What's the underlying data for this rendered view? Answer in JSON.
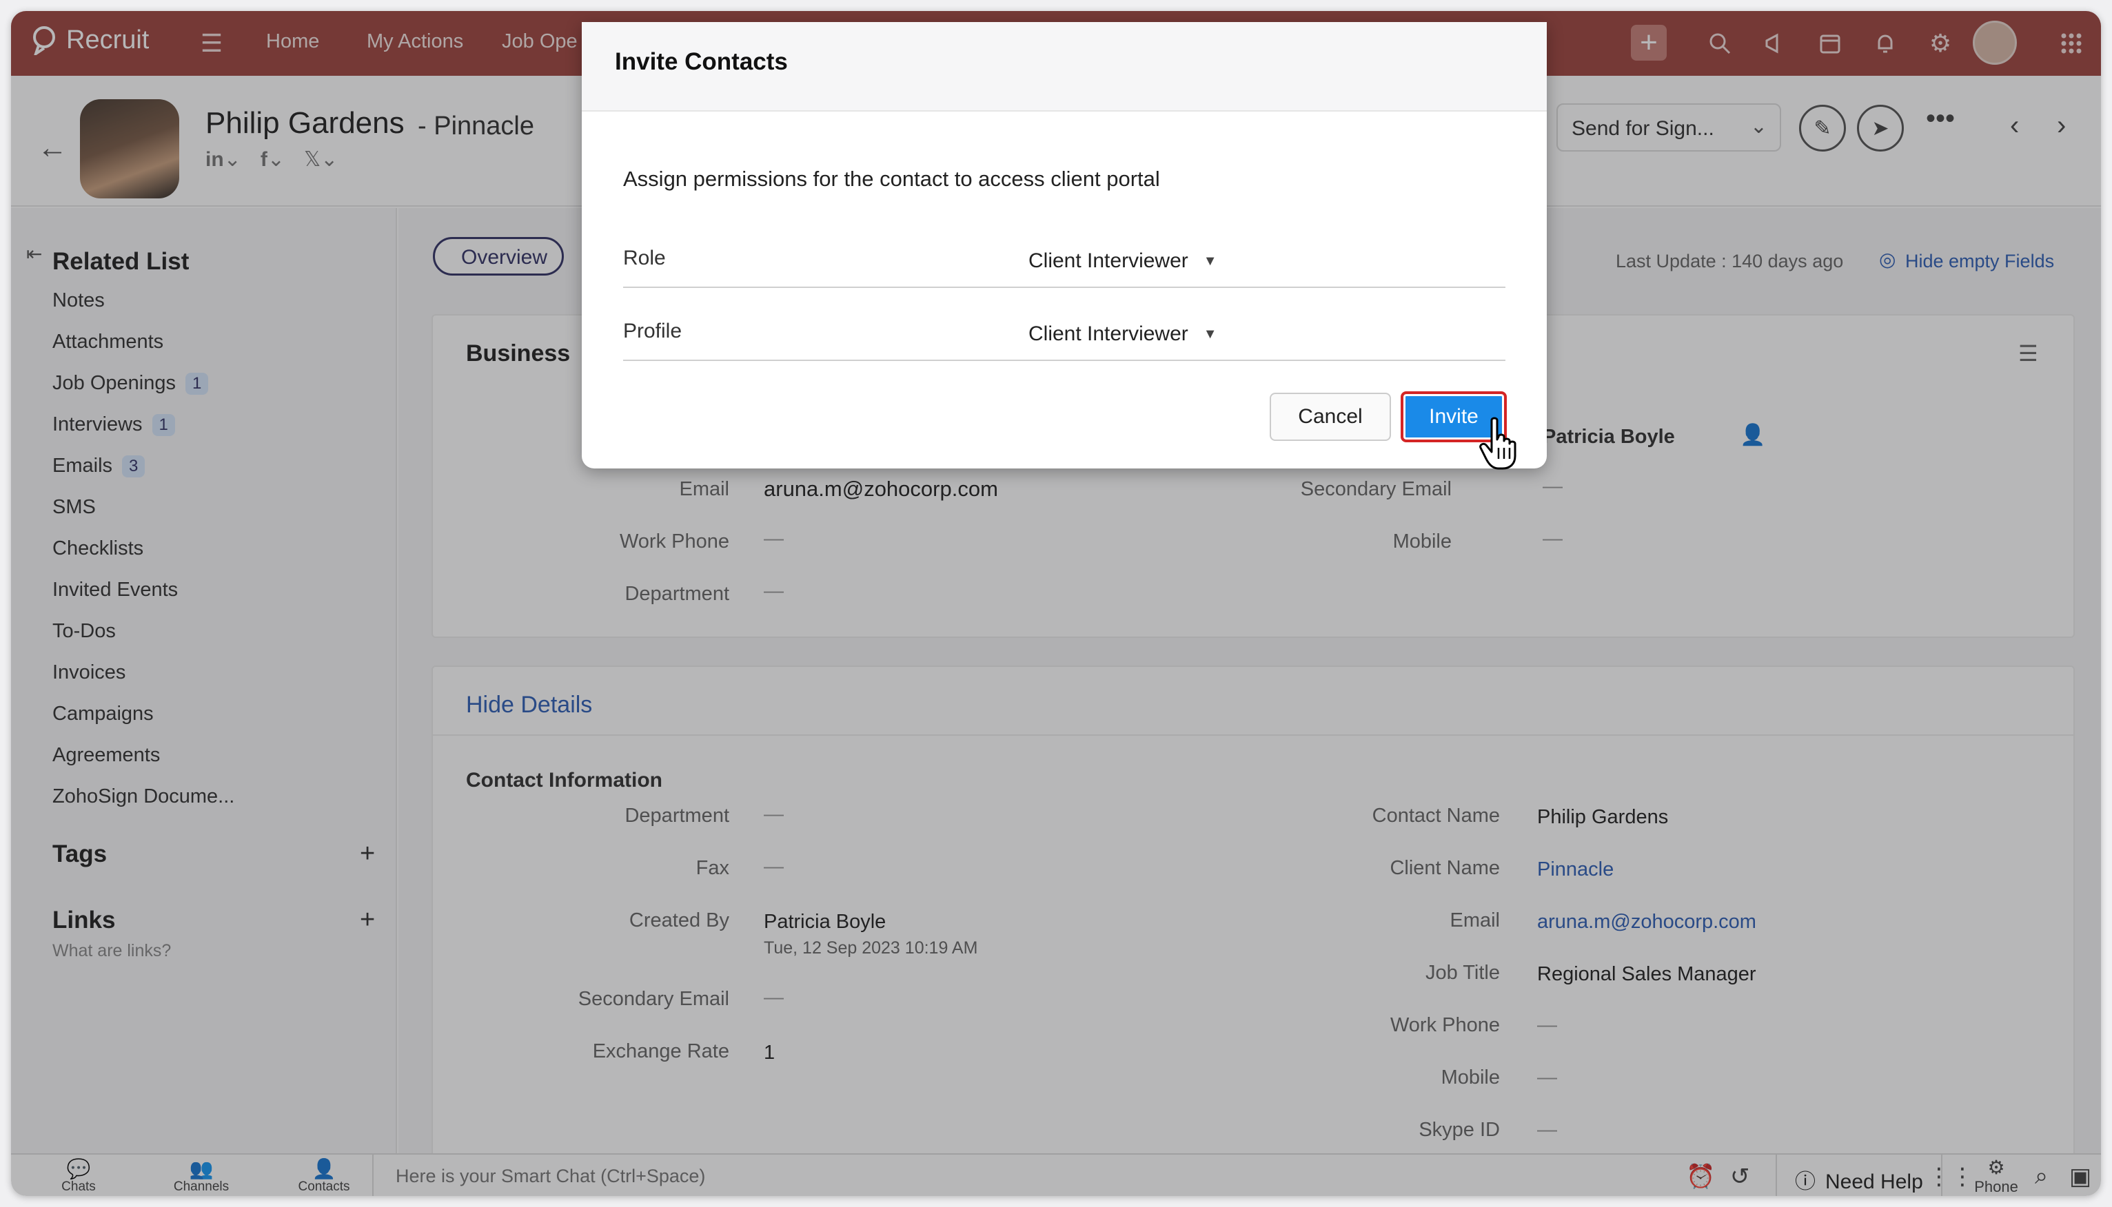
{
  "topbar": {
    "app_name": "Recruit",
    "nav": [
      "Home",
      "My Actions",
      "Job Ope"
    ]
  },
  "header": {
    "contact_name": "Philip Gardens",
    "client_name": "Pinnacle",
    "social": [
      "in",
      "f",
      "𝕏"
    ],
    "send_for_sign": "Send for Sign..."
  },
  "sidebar": {
    "related_title": "Related List",
    "items": [
      {
        "label": "Notes",
        "badge": ""
      },
      {
        "label": "Attachments",
        "badge": ""
      },
      {
        "label": "Job Openings",
        "badge": "1"
      },
      {
        "label": "Interviews",
        "badge": "1"
      },
      {
        "label": "Emails",
        "badge": "3"
      },
      {
        "label": "SMS",
        "badge": ""
      },
      {
        "label": "Checklists",
        "badge": ""
      },
      {
        "label": "Invited Events",
        "badge": ""
      },
      {
        "label": "To-Dos",
        "badge": ""
      },
      {
        "label": "Invoices",
        "badge": ""
      },
      {
        "label": "Campaigns",
        "badge": ""
      },
      {
        "label": "Agreements",
        "badge": ""
      },
      {
        "label": "ZohoSign Docume...",
        "badge": ""
      }
    ],
    "tags_title": "Tags",
    "links_title": "Links",
    "links_hint": "What are links?"
  },
  "main": {
    "tab_overview": "Overview",
    "last_update": "Last Update : 140 days ago",
    "hide_empty": "Hide empty Fields",
    "business_card": {
      "title": "Business",
      "owner_value": "Patricia Boyle",
      "email_label": "Email",
      "email_value": "aruna.m@zohocorp.com",
      "work_phone_label": "Work Phone",
      "department_label": "Department",
      "secondary_email_label": "Secondary Email",
      "mobile_label": "Mobile",
      "dash": "—"
    },
    "details_card": {
      "hide_details": "Hide Details",
      "section_title": "Contact Information",
      "left": [
        {
          "label": "Department",
          "value": "—"
        },
        {
          "label": "Fax",
          "value": "—"
        },
        {
          "label": "Created By",
          "value": "Patricia Boyle",
          "sub": "Tue, 12 Sep 2023 10:19 AM"
        },
        {
          "label": "Secondary Email",
          "value": "—"
        },
        {
          "label": "Exchange Rate",
          "value": "1"
        }
      ],
      "right": [
        {
          "label": "Contact Name",
          "value": "Philip Gardens"
        },
        {
          "label": "Client Name",
          "value": "Pinnacle"
        },
        {
          "label": "Email",
          "value": "aruna.m@zohocorp.com"
        },
        {
          "label": "Job Title",
          "value": "Regional Sales Manager"
        },
        {
          "label": "Work Phone",
          "value": "—"
        },
        {
          "label": "Mobile",
          "value": "—"
        },
        {
          "label": "Skype ID",
          "value": "—"
        }
      ]
    }
  },
  "bottombar": {
    "tabs": [
      "Chats",
      "Channels",
      "Contacts"
    ],
    "chat_placeholder": "Here is your Smart Chat (Ctrl+Space)",
    "need_help": "Need Help",
    "phone": "Phone"
  },
  "dialog": {
    "title": "Invite Contacts",
    "description": "Assign permissions for the contact to access client portal",
    "role_label": "Role",
    "role_value": "Client Interviewer",
    "profile_label": "Profile",
    "profile_value": "Client Interviewer",
    "cancel": "Cancel",
    "invite": "Invite"
  },
  "colors": {
    "topbar": "#9e4640",
    "invite_button": "#1a8ae8",
    "highlight_border": "#d42525",
    "link": "#2f5fb5"
  }
}
